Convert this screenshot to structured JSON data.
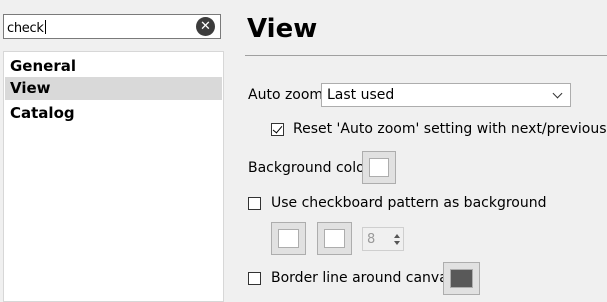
{
  "search": {
    "value": "check"
  },
  "nav": {
    "items": [
      {
        "label": "General",
        "selected": false
      },
      {
        "label": "View",
        "selected": true
      },
      {
        "label": "Catalog",
        "selected": false
      }
    ]
  },
  "page": {
    "title": "View",
    "auto_zoom": {
      "label": "Auto zoom",
      "value": "Last used"
    },
    "reset_auto_zoom": {
      "label": "Reset 'Auto zoom' setting with next/previous file",
      "checked": true
    },
    "background_color": {
      "label": "Background color",
      "color": "#ffffff"
    },
    "checkboard": {
      "label": "Use checkboard pattern as background",
      "checked": false,
      "color1": "#ffffff",
      "color2": "#ffffff",
      "size": "8"
    },
    "border_line": {
      "label": "Border line around canvas",
      "checked": false,
      "color": "#595959"
    }
  }
}
